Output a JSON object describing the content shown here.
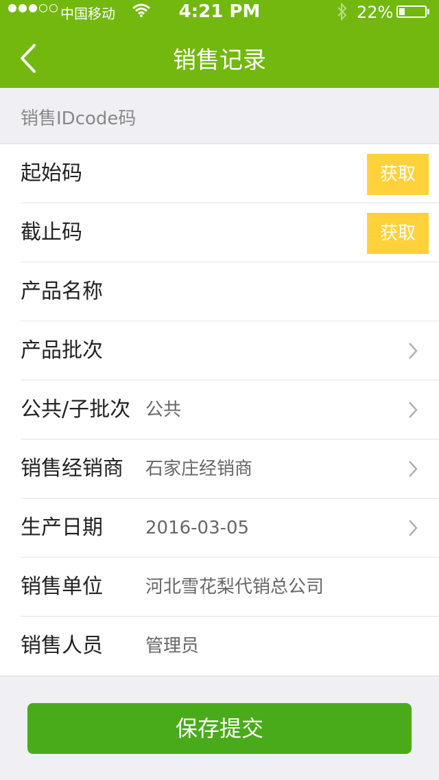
{
  "status_bar": {
    "carrier": "中国移动",
    "time": "4:21 PM",
    "battery": "22%",
    "signal_filled": 3,
    "signal_total": 5,
    "battery_level": 0.22
  },
  "nav": {
    "title": "销售记录",
    "back_icon": "chevron-left-icon"
  },
  "section": {
    "label": "销售IDcode码"
  },
  "rows": [
    {
      "label": "起始码",
      "button": "获取"
    },
    {
      "label": "截止码",
      "button": "获取"
    },
    {
      "label": "产品名称",
      "value": ""
    },
    {
      "label": "产品批次",
      "value": ""
    },
    {
      "label": "公共/子批次",
      "value": "公共"
    },
    {
      "label": "销售经销商",
      "value": "石家庄经销商"
    },
    {
      "label": "生产日期",
      "value": "2016-03-05"
    },
    {
      "label": "销售单位",
      "value": "河北雪花梨代销总公司"
    },
    {
      "label": "销售人员",
      "value": "管理员"
    }
  ],
  "submit": {
    "label": "保存提交"
  },
  "colors": {
    "header": "#72b80f",
    "fetch_button": "#ffd23c",
    "submit_button": "#4aab1a",
    "background": "#efeff4"
  }
}
